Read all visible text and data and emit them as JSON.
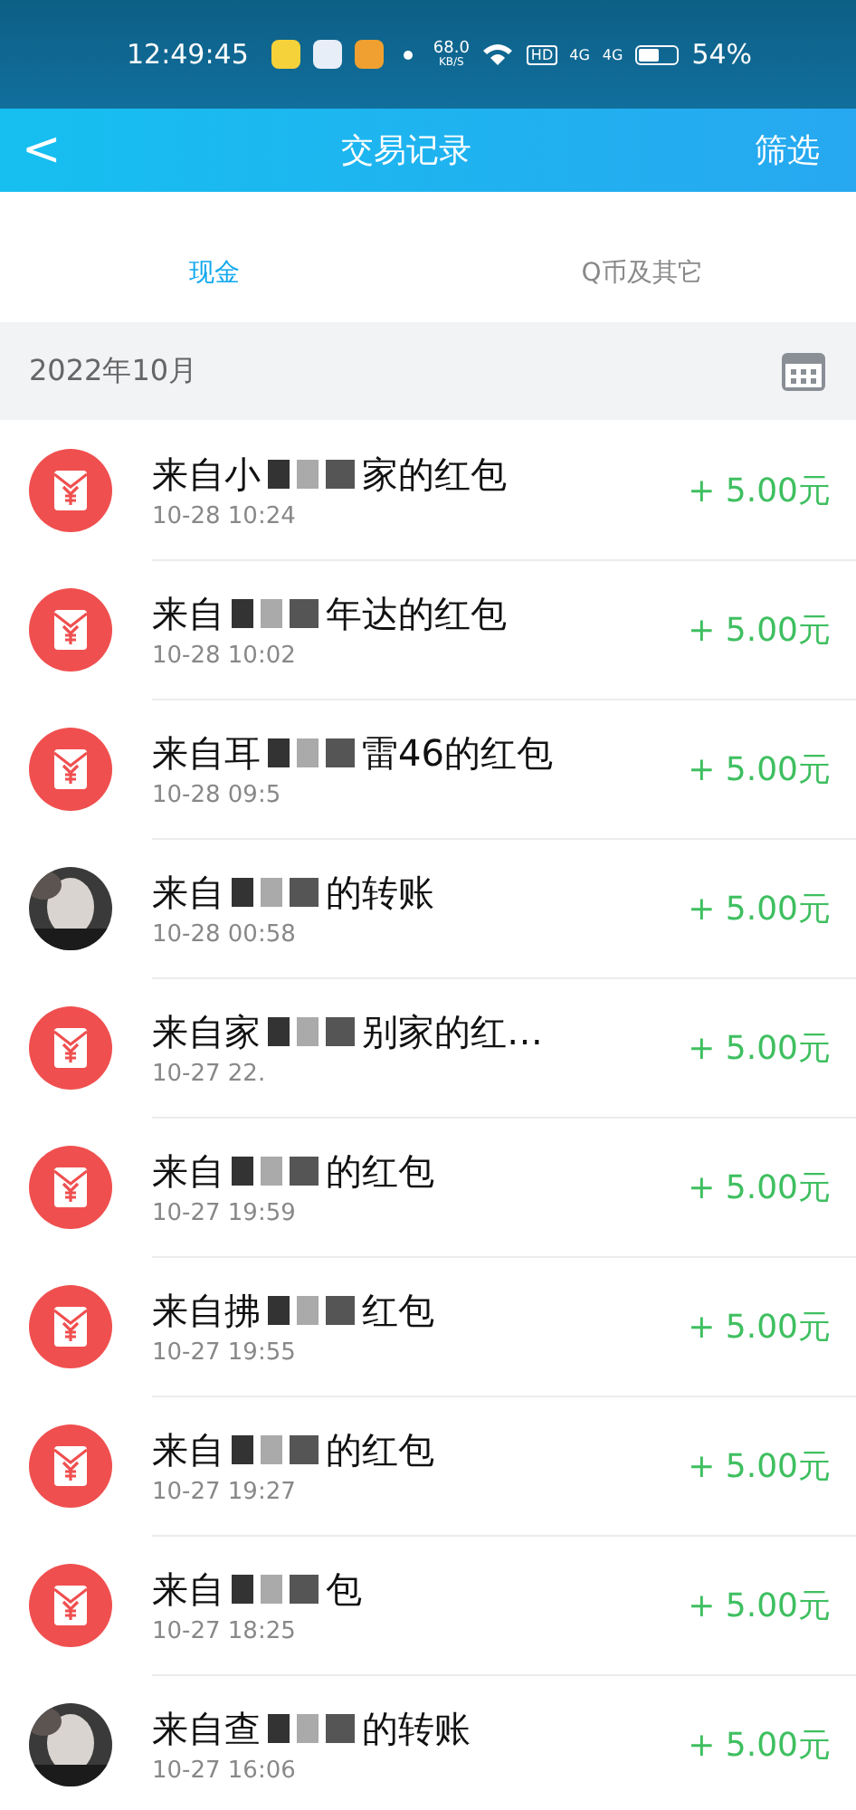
{
  "status_bar": {
    "time": "12:49:45",
    "speed": "68.0",
    "speed_unit": "KB/S",
    "hd": "HD",
    "sim1": "4G",
    "sim2": "4G",
    "battery": "54%"
  },
  "header": {
    "back": "<",
    "title": "交易记录",
    "filter": "筛选"
  },
  "tabs": [
    {
      "label": "现金",
      "selected": true
    },
    {
      "label": "Q币及其它",
      "selected": false
    }
  ],
  "month": {
    "label": "2022年10月"
  },
  "records": [
    {
      "kind": "redpacket",
      "title_start": "来自小",
      "title_end": "家的红包",
      "time": "10-28 10:24",
      "amount": "+ 5.00元"
    },
    {
      "kind": "redpacket",
      "title_start": "来自",
      "title_end": "年达的红包",
      "time": "10-28 10:02",
      "amount": "+ 5.00元"
    },
    {
      "kind": "redpacket",
      "title_start": "来自耳",
      "title_end": "雷46的红包",
      "time": "10-28 09:5",
      "amount": "+ 5.00元"
    },
    {
      "kind": "avatar",
      "title_start": "来自",
      "title_end": "的转账",
      "time": "10-28 00:58",
      "amount": "+ 5.00元"
    },
    {
      "kind": "redpacket",
      "title_start": "来自家",
      "title_end": "别家的红…",
      "time": "10-27 22.",
      "amount": "+ 5.00元"
    },
    {
      "kind": "redpacket",
      "title_start": "来自",
      "title_end": "的红包",
      "time": "10-27 19:59",
      "amount": "+ 5.00元"
    },
    {
      "kind": "redpacket",
      "title_start": "来自拂",
      "title_end": "红包",
      "time": "10-27 19:55",
      "amount": "+ 5.00元"
    },
    {
      "kind": "redpacket",
      "title_start": "来自",
      "title_end": "的红包",
      "time": "10-27 19:27",
      "amount": "+ 5.00元"
    },
    {
      "kind": "redpacket",
      "title_start": "来自",
      "title_end": "包",
      "time": "10-27 18:25",
      "amount": "+ 5.00元"
    },
    {
      "kind": "avatar",
      "title_start": "来自查",
      "title_end": "的转账",
      "time": "10-27 16:06",
      "amount": "+ 5.00元"
    }
  ]
}
